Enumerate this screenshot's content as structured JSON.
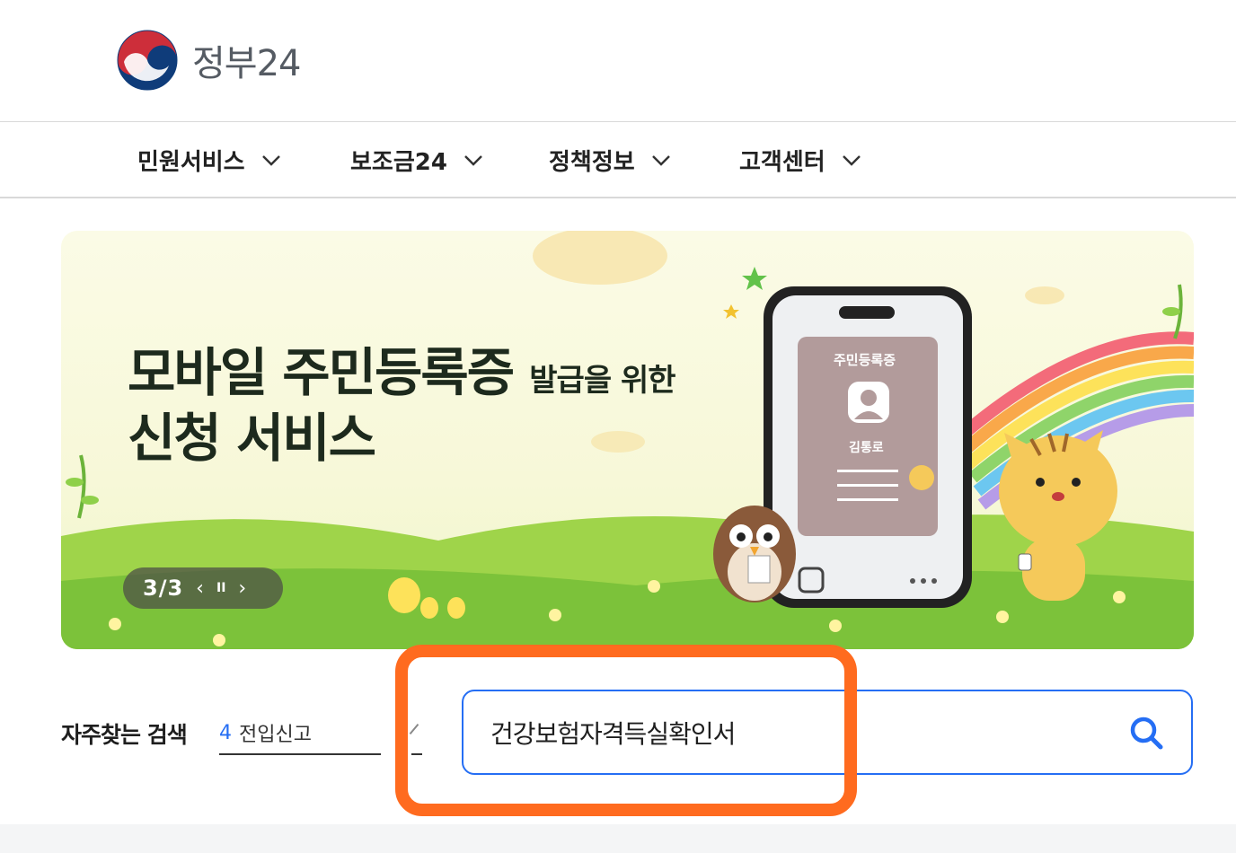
{
  "header": {
    "logo_text": "정부24",
    "brand_colors": {
      "red": "#cd2e3a",
      "blue": "#0f3c7a"
    }
  },
  "nav": {
    "items": [
      {
        "label": "민원서비스"
      },
      {
        "label": "보조금24"
      },
      {
        "label": "정책정보"
      },
      {
        "label": "고객센터"
      }
    ]
  },
  "banner": {
    "title_line1": "모바일 주민등록증",
    "title_line1_small": "발급을 위한",
    "title_line2": "신청 서비스",
    "card_title": "주민등록증",
    "card_name": "김통로",
    "pager": {
      "count": "3/3",
      "prev": "‹",
      "pause": "II",
      "next": "›"
    }
  },
  "search": {
    "faq_label": "자주찾는 검색",
    "faq_items": [
      {
        "num": "4",
        "text": "전입신고"
      }
    ],
    "input_value": "건강보험자격득실확인서",
    "accent_color": "#256ef4",
    "highlight_color": "#ff6b1f"
  }
}
